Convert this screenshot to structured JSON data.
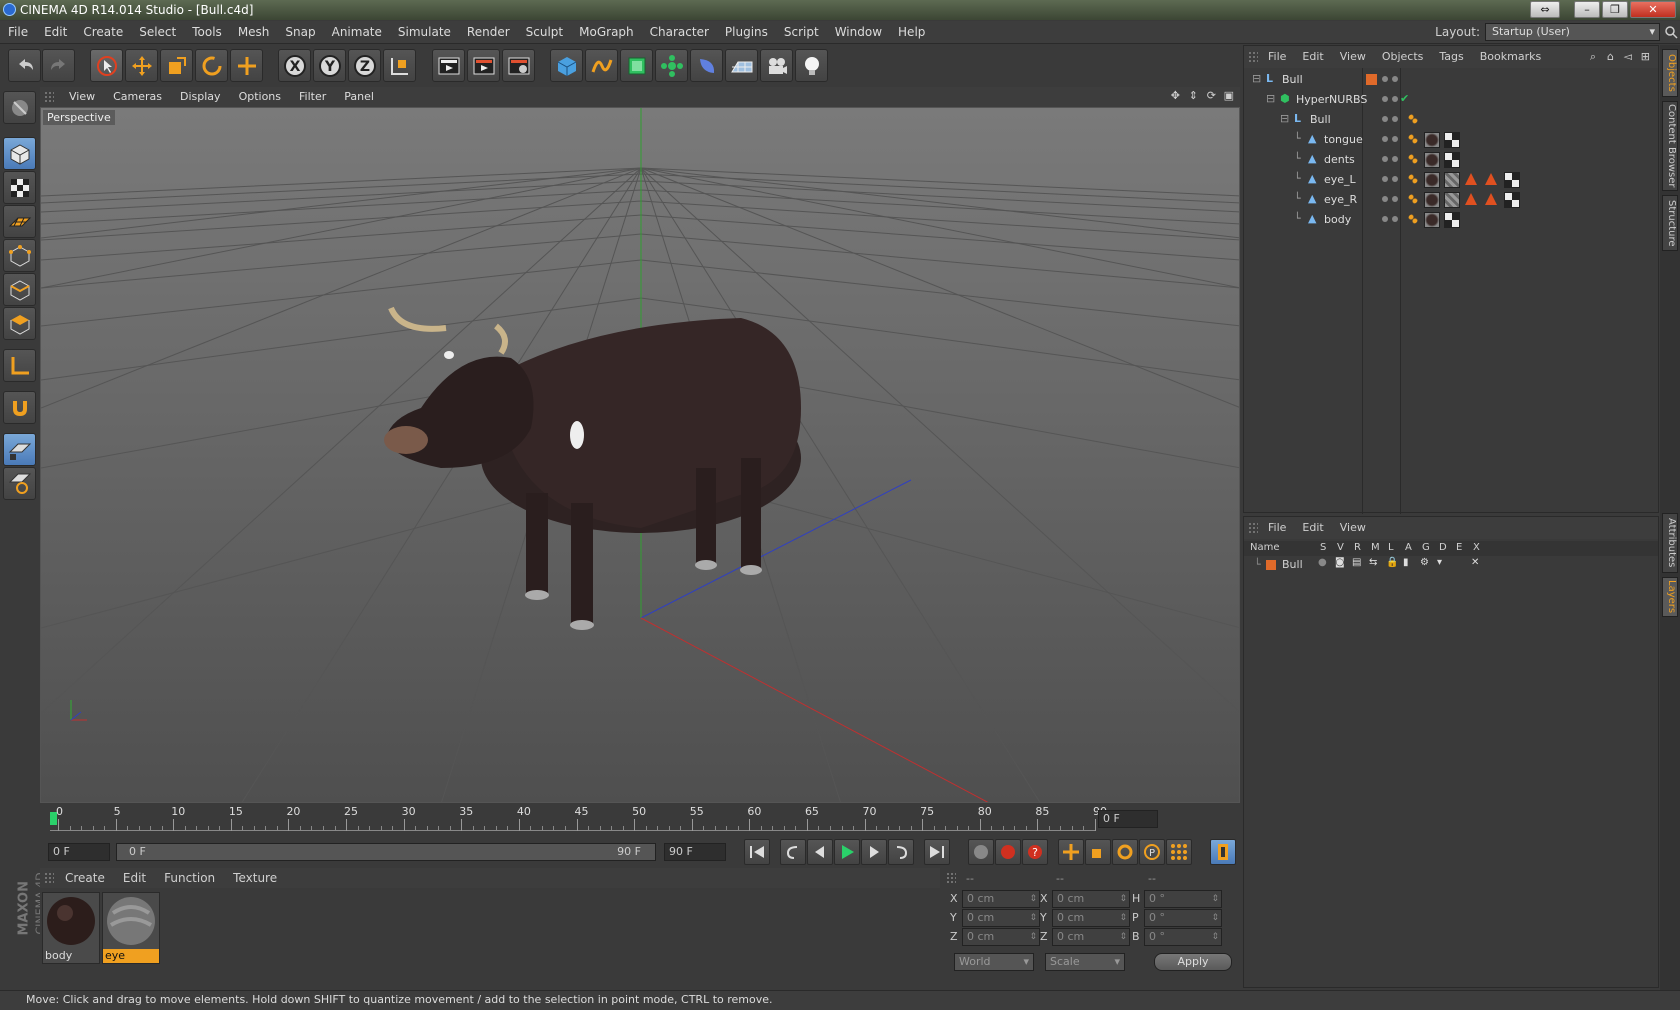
{
  "window": {
    "title": "CINEMA 4D R14.014 Studio - [Bull.c4d]",
    "controls": [
      "⇔",
      "–",
      "❐",
      "✕"
    ]
  },
  "menubar": {
    "items": [
      "File",
      "Edit",
      "Create",
      "Select",
      "Tools",
      "Mesh",
      "Snap",
      "Animate",
      "Simulate",
      "Render",
      "Sculpt",
      "MoGraph",
      "Character",
      "Plugins",
      "Script",
      "Window",
      "Help"
    ],
    "layout_label": "Layout:",
    "layout_value": "Startup (User)"
  },
  "viewport": {
    "menu": [
      "View",
      "Cameras",
      "Display",
      "Options",
      "Filter",
      "Panel"
    ],
    "label": "Perspective"
  },
  "timeline": {
    "ticks": [
      "0",
      "5",
      "10",
      "15",
      "20",
      "25",
      "30",
      "35",
      "40",
      "45",
      "50",
      "55",
      "60",
      "65",
      "70",
      "75",
      "80",
      "85",
      "90"
    ],
    "current_frame": "0 F"
  },
  "playbar": {
    "start_field": "0 F",
    "range_start": "0 F",
    "range_end": "90 F",
    "end_field": "90 F"
  },
  "materials": {
    "menu": [
      "Create",
      "Edit",
      "Function",
      "Texture"
    ],
    "items": [
      {
        "name": "body",
        "selected": false
      },
      {
        "name": "eye",
        "selected": true
      }
    ]
  },
  "coordinates": {
    "headers": [
      "--",
      "--",
      "--"
    ],
    "rows": [
      {
        "a": "X",
        "a_val": "0 cm",
        "b": "X",
        "b_val": "0 cm",
        "c": "H",
        "c_val": "0 °"
      },
      {
        "a": "Y",
        "a_val": "0 cm",
        "b": "Y",
        "b_val": "0 cm",
        "c": "P",
        "c_val": "0 °"
      },
      {
        "a": "Z",
        "a_val": "0 cm",
        "b": "Z",
        "b_val": "0 cm",
        "c": "B",
        "c_val": "0 °"
      }
    ],
    "mode_select": "World",
    "scale_select": "Scale",
    "apply": "Apply"
  },
  "objects": {
    "menu": [
      "File",
      "Edit",
      "View",
      "Objects",
      "Tags",
      "Bookmarks"
    ],
    "rows": [
      {
        "name": "Bull",
        "indent": 0
      },
      {
        "name": "HyperNURBS",
        "indent": 1
      },
      {
        "name": "Bull",
        "indent": 2
      },
      {
        "name": "tongue",
        "indent": 3
      },
      {
        "name": "dents",
        "indent": 3
      },
      {
        "name": "eye_L",
        "indent": 3
      },
      {
        "name": "eye_R",
        "indent": 3
      },
      {
        "name": "body",
        "indent": 3
      }
    ]
  },
  "layers": {
    "menu": [
      "File",
      "Edit",
      "View"
    ],
    "columns": [
      "Name",
      "S",
      "V",
      "R",
      "M",
      "L",
      "A",
      "G",
      "D",
      "E",
      "X"
    ],
    "rows": [
      {
        "name": "Bull",
        "color": "#e06a2a"
      }
    ]
  },
  "side_tabs": [
    "Objects",
    "Content Browser",
    "Structure",
    "Attributes",
    "Layers"
  ],
  "status": "Move: Click and drag to move elements. Hold down SHIFT to quantize movement / add to the selection in point mode, CTRL to remove.",
  "brand": {
    "line1": "MAXON",
    "line2": "CINEMA 4D"
  },
  "colors": {
    "accent_orange": "#f0a020",
    "axis_x": "#c03030",
    "axis_y": "#30b030",
    "axis_z": "#3040c0"
  }
}
